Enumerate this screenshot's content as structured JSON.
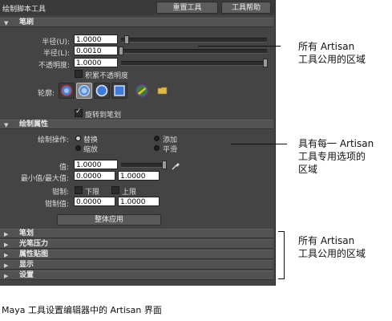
{
  "window": {
    "title": "绘制脚本工具",
    "reset_button": "重置工具",
    "help_button": "工具帮助"
  },
  "brush_section": {
    "header": "笔刷",
    "radius_u_label": "半径(U):",
    "radius_u_value": "1.0000",
    "radius_u_level": 0.02,
    "radius_l_label": "半径(L):",
    "radius_l_value": "0.0010",
    "radius_l_level": 0.0,
    "opacity_label": "不透明度:",
    "opacity_value": "1.0000",
    "opacity_level": 1.0,
    "accumulate_label": "积累不透明度",
    "accumulate_checked": false,
    "profile_label": "轮廓:",
    "rotate_label": "旋转到笔划",
    "rotate_checked": true
  },
  "paint_attrs_section": {
    "header": "绘制属性",
    "op_label": "绘制操作:",
    "ops": [
      {
        "label": "替换",
        "selected": true
      },
      {
        "label": "添加",
        "selected": false
      },
      {
        "label": "缩放",
        "selected": false
      },
      {
        "label": "平滑",
        "selected": false
      }
    ],
    "value_label": "值:",
    "value_value": "1.0000",
    "value_level": 1.0,
    "minmax_label": "最小值/最大值:",
    "min_value": "0.0000",
    "max_value": "1.0000",
    "clamp_label": "钳制:",
    "clamp_lower": "下限",
    "clamp_upper": "上限",
    "clamp_values_label": "钳制值:",
    "clamp_min": "0.0000",
    "clamp_max": "1.0000",
    "flood_button": "整体应用"
  },
  "collapsed_sections": [
    "笔划",
    "光笔压力",
    "属性贴图",
    "显示",
    "设置"
  ],
  "annotations": {
    "top_line1": "所有 Artisan",
    "top_line2": "工具公用的区域",
    "mid_line1": "具有每一 Artisan",
    "mid_line2": "工具专用选项的",
    "mid_line3": "区域",
    "bottom_line1": "所有 Artisan",
    "bottom_line2": "工具公用的区域"
  },
  "caption": "Maya 工具设置编辑器中的 Artisan 界面"
}
